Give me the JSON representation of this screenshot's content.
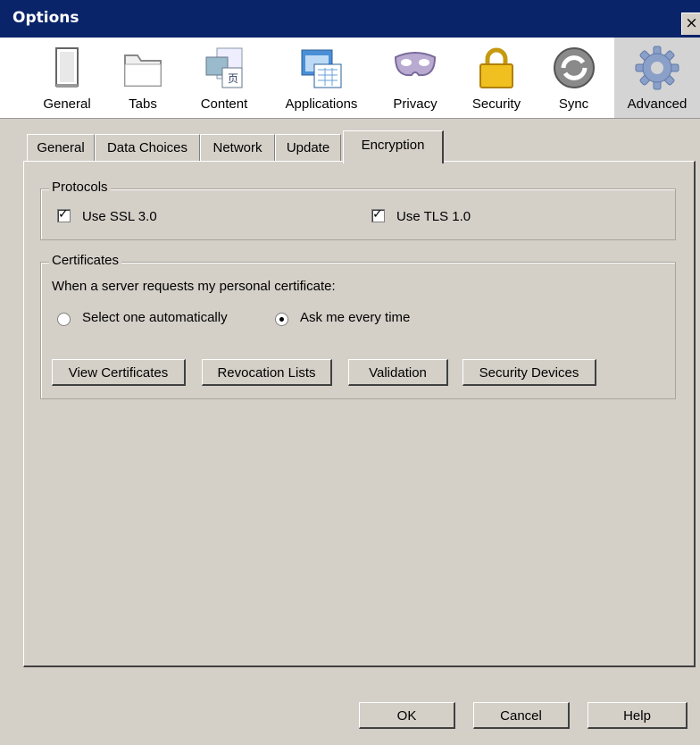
{
  "window": {
    "title": "Options",
    "close_glyph": "×"
  },
  "panes": [
    {
      "label": "General",
      "icon": "general-icon"
    },
    {
      "label": "Tabs",
      "icon": "tabs-icon"
    },
    {
      "label": "Content",
      "icon": "content-icon"
    },
    {
      "label": "Applications",
      "icon": "applications-icon"
    },
    {
      "label": "Privacy",
      "icon": "privacy-mask-icon"
    },
    {
      "label": "Security",
      "icon": "padlock-icon"
    },
    {
      "label": "Sync",
      "icon": "sync-icon"
    },
    {
      "label": "Advanced",
      "icon": "gear-icon",
      "selected": true
    }
  ],
  "tabs": [
    {
      "label": "General"
    },
    {
      "label": "Data Choices"
    },
    {
      "label": "Network"
    },
    {
      "label": "Update"
    },
    {
      "label": "Encryption",
      "active": true
    }
  ],
  "protocols": {
    "title": "Protocols",
    "ssl": {
      "label": "Use SSL 3.0",
      "checked": true
    },
    "tls": {
      "label": "Use TLS 1.0",
      "checked": true
    }
  },
  "certificates": {
    "title": "Certificates",
    "prompt": "When a server requests my personal certificate:",
    "options": [
      {
        "label": "Select one automatically",
        "selected": false
      },
      {
        "label": "Ask me every time",
        "selected": true
      }
    ],
    "buttons": {
      "view": "View Certificates",
      "revocation": "Revocation Lists",
      "validation": "Validation",
      "devices": "Security Devices"
    }
  },
  "footer": {
    "ok": "OK",
    "cancel": "Cancel",
    "help": "Help"
  },
  "glyphs": {
    "check": "✓"
  },
  "colors": {
    "titlebar": "#0a246a",
    "dialog": "#d4d0c8",
    "toolbar": "#ffffff"
  }
}
